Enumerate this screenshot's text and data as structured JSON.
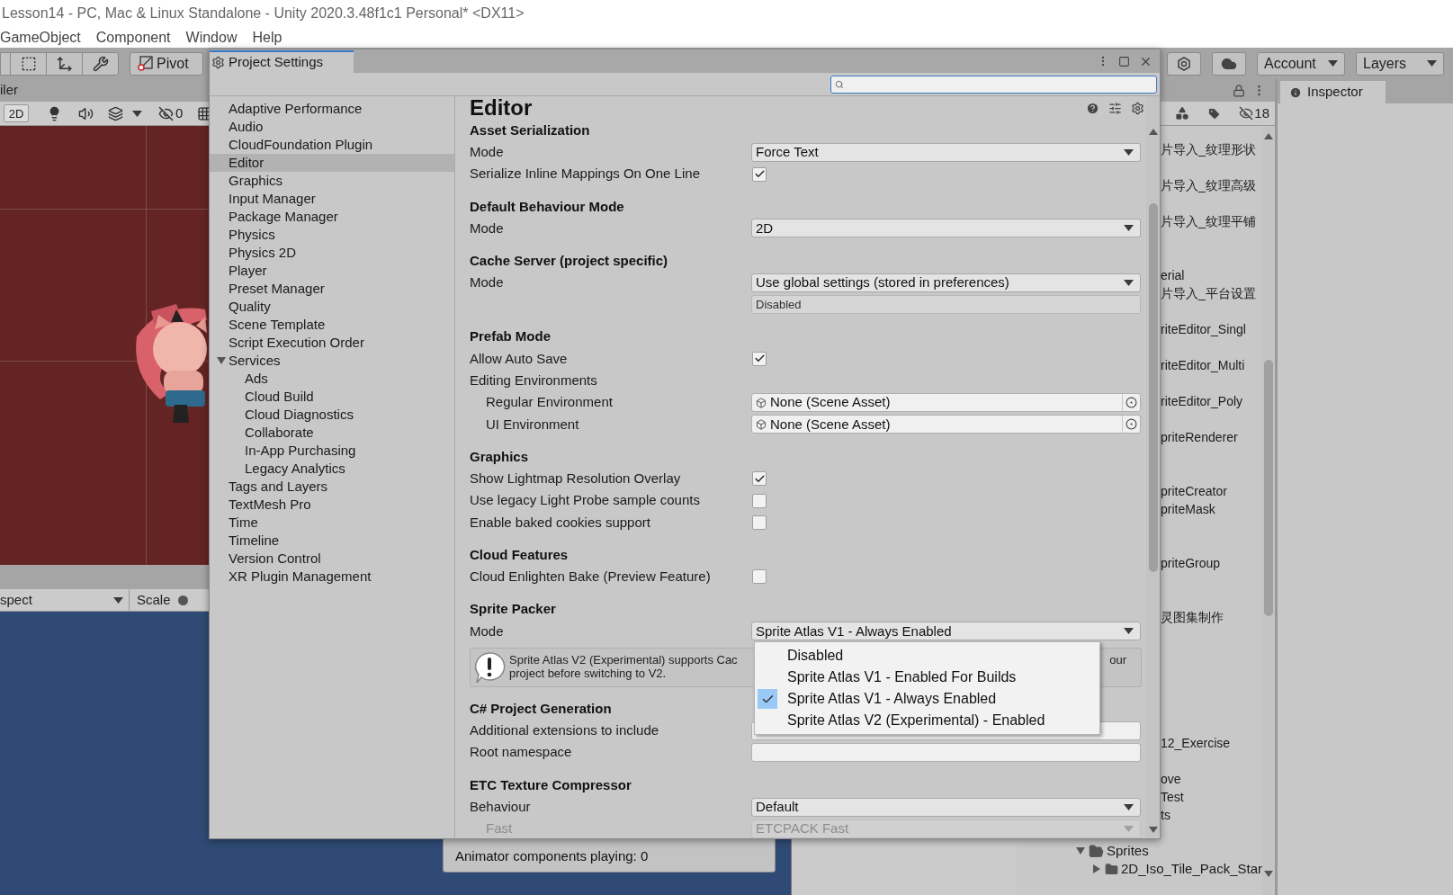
{
  "window_title": "Lesson14 - PC, Mac & Linux Standalone - Unity 2020.3.48f1c1 Personal* <DX11>",
  "menu": [
    "GameObject",
    "Component",
    "Window",
    "Help"
  ],
  "toolbar": {
    "pivot": "Pivot",
    "account": "Account",
    "layers": "Layers"
  },
  "scene": {
    "tab": "iler",
    "mode_2d": "2D",
    "hidden_count": "0"
  },
  "game": {
    "aspect": "spect",
    "scale": "Scale",
    "stats": "Animator components playing: 0"
  },
  "project_settings": {
    "title": "Project Settings",
    "categories": [
      {
        "label": "Adaptive Performance",
        "selected": false
      },
      {
        "label": "Audio",
        "selected": false
      },
      {
        "label": "CloudFoundation Plugin",
        "selected": false
      },
      {
        "label": "Editor",
        "selected": true
      },
      {
        "label": "Graphics",
        "selected": false
      },
      {
        "label": "Input Manager",
        "selected": false
      },
      {
        "label": "Package Manager",
        "selected": false
      },
      {
        "label": "Physics",
        "selected": false
      },
      {
        "label": "Physics 2D",
        "selected": false
      },
      {
        "label": "Player",
        "selected": false
      },
      {
        "label": "Preset Manager",
        "selected": false
      },
      {
        "label": "Quality",
        "selected": false
      },
      {
        "label": "Scene Template",
        "selected": false
      },
      {
        "label": "Script Execution Order",
        "selected": false
      },
      {
        "label": "Services",
        "selected": false,
        "expanded": true,
        "children": [
          {
            "label": "Ads",
            "selected": false
          },
          {
            "label": "Cloud Build",
            "selected": false
          },
          {
            "label": "Cloud Diagnostics",
            "selected": false
          },
          {
            "label": "Collaborate",
            "selected": false
          },
          {
            "label": "In-App Purchasing",
            "selected": false
          },
          {
            "label": "Legacy Analytics",
            "selected": false
          }
        ]
      },
      {
        "label": "Tags and Layers",
        "selected": false
      },
      {
        "label": "TextMesh Pro",
        "selected": false
      },
      {
        "label": "Time",
        "selected": false
      },
      {
        "label": "Timeline",
        "selected": false
      },
      {
        "label": "Version Control",
        "selected": false
      },
      {
        "label": "XR Plugin Management",
        "selected": false
      }
    ],
    "editor": {
      "title": "Editor",
      "sections": [
        {
          "title": "Asset Serialization",
          "rows": [
            {
              "kind": "dropdown",
              "label": "Mode",
              "value": "Force Text"
            },
            {
              "kind": "checkbox",
              "label": "Serialize Inline Mappings On One Line",
              "checked": true
            }
          ]
        },
        {
          "title": "Default Behaviour Mode",
          "rows": [
            {
              "kind": "dropdown",
              "label": "Mode",
              "value": "2D"
            }
          ]
        },
        {
          "title": "Cache Server (project specific)",
          "rows": [
            {
              "kind": "dropdown",
              "label": "Mode",
              "value": "Use global settings (stored in preferences)"
            },
            {
              "kind": "readonly",
              "value": "Disabled"
            }
          ]
        },
        {
          "title": "Prefab Mode",
          "rows": [
            {
              "kind": "checkbox",
              "label": "Allow Auto Save",
              "checked": true
            },
            {
              "kind": "label",
              "label": "Editing Environments",
              "children": [
                {
                  "kind": "object",
                  "label": "Regular Environment",
                  "value": "None (Scene Asset)"
                },
                {
                  "kind": "object",
                  "label": "UI Environment",
                  "value": "None (Scene Asset)"
                }
              ]
            }
          ]
        },
        {
          "title": "Graphics",
          "rows": [
            {
              "kind": "checkbox",
              "label": "Show Lightmap Resolution Overlay",
              "checked": true
            },
            {
              "kind": "checkbox",
              "label": "Use legacy Light Probe sample counts",
              "checked": false
            },
            {
              "kind": "checkbox",
              "label": "Enable baked cookies support",
              "checked": false
            }
          ]
        },
        {
          "title": "Cloud Features",
          "rows": [
            {
              "kind": "checkbox",
              "label": "Cloud Enlighten Bake (Preview Feature)",
              "checked": false
            }
          ]
        },
        {
          "title": "Sprite Packer",
          "rows": [
            {
              "kind": "dropdown",
              "label": "Mode",
              "value": "Sprite Atlas V1 - Always Enabled"
            },
            {
              "kind": "help",
              "text_start": "Sprite Atlas V2 (Experimental) supports Cac",
              "text_end": "our",
              "text_line_2": "project before switching to V2."
            }
          ]
        },
        {
          "title": "C# Project Generation",
          "rows": [
            {
              "kind": "field",
              "label": "Additional extensions to include"
            },
            {
              "kind": "field",
              "label": "Root namespace"
            }
          ]
        },
        {
          "title": "ETC Texture Compressor",
          "rows": [
            {
              "kind": "dropdown",
              "label": "Behaviour",
              "value": "Default",
              "children": [
                {
                  "kind": "dropdown",
                  "label": "Fast",
                  "value": "ETCPACK Fast",
                  "disabled": true
                }
              ]
            }
          ]
        }
      ]
    }
  },
  "dropdown_menu": [
    {
      "label": "Disabled",
      "selected": false
    },
    {
      "label": "Sprite Atlas V1 - Enabled For Builds",
      "selected": false
    },
    {
      "label": "Sprite Atlas V1 - Always Enabled",
      "selected": true
    },
    {
      "label": "Sprite Atlas V2 (Experimental) - Enabled",
      "selected": false
    }
  ],
  "project": {
    "hidden_count": "18",
    "items": [
      "片导入_纹理形状",
      "片导入_纹理高级",
      "片导入_纹理平铺",
      "erial",
      "片导入_平台设置",
      "riteEditor_Singl",
      "riteEditor_Multi",
      "riteEditor_Poly",
      "priteRenderer",
      "priteCreator",
      "priteMask",
      "priteGroup",
      "灵图集制作",
      "12_Exercise",
      "ove",
      "Test",
      "ts"
    ],
    "tree": [
      {
        "label": "Sprites",
        "expanded": true,
        "children": [
          {
            "label": "2D_Iso_Tile_Pack_Star",
            "expanded": false
          }
        ]
      }
    ]
  },
  "inspector": {
    "tab": "Inspector"
  }
}
